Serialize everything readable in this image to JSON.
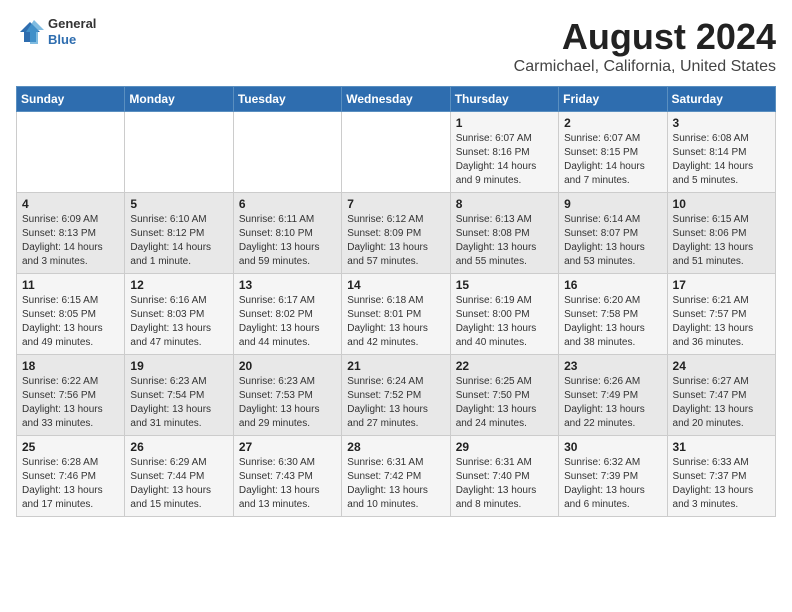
{
  "header": {
    "logo": {
      "line1": "General",
      "line2": "Blue"
    },
    "title": "August 2024",
    "subtitle": "Carmichael, California, United States"
  },
  "weekdays": [
    "Sunday",
    "Monday",
    "Tuesday",
    "Wednesday",
    "Thursday",
    "Friday",
    "Saturday"
  ],
  "weeks": [
    [
      {
        "day": "",
        "info": ""
      },
      {
        "day": "",
        "info": ""
      },
      {
        "day": "",
        "info": ""
      },
      {
        "day": "",
        "info": ""
      },
      {
        "day": "1",
        "info": "Sunrise: 6:07 AM\nSunset: 8:16 PM\nDaylight: 14 hours\nand 9 minutes."
      },
      {
        "day": "2",
        "info": "Sunrise: 6:07 AM\nSunset: 8:15 PM\nDaylight: 14 hours\nand 7 minutes."
      },
      {
        "day": "3",
        "info": "Sunrise: 6:08 AM\nSunset: 8:14 PM\nDaylight: 14 hours\nand 5 minutes."
      }
    ],
    [
      {
        "day": "4",
        "info": "Sunrise: 6:09 AM\nSunset: 8:13 PM\nDaylight: 14 hours\nand 3 minutes."
      },
      {
        "day": "5",
        "info": "Sunrise: 6:10 AM\nSunset: 8:12 PM\nDaylight: 14 hours\nand 1 minute."
      },
      {
        "day": "6",
        "info": "Sunrise: 6:11 AM\nSunset: 8:10 PM\nDaylight: 13 hours\nand 59 minutes."
      },
      {
        "day": "7",
        "info": "Sunrise: 6:12 AM\nSunset: 8:09 PM\nDaylight: 13 hours\nand 57 minutes."
      },
      {
        "day": "8",
        "info": "Sunrise: 6:13 AM\nSunset: 8:08 PM\nDaylight: 13 hours\nand 55 minutes."
      },
      {
        "day": "9",
        "info": "Sunrise: 6:14 AM\nSunset: 8:07 PM\nDaylight: 13 hours\nand 53 minutes."
      },
      {
        "day": "10",
        "info": "Sunrise: 6:15 AM\nSunset: 8:06 PM\nDaylight: 13 hours\nand 51 minutes."
      }
    ],
    [
      {
        "day": "11",
        "info": "Sunrise: 6:15 AM\nSunset: 8:05 PM\nDaylight: 13 hours\nand 49 minutes."
      },
      {
        "day": "12",
        "info": "Sunrise: 6:16 AM\nSunset: 8:03 PM\nDaylight: 13 hours\nand 47 minutes."
      },
      {
        "day": "13",
        "info": "Sunrise: 6:17 AM\nSunset: 8:02 PM\nDaylight: 13 hours\nand 44 minutes."
      },
      {
        "day": "14",
        "info": "Sunrise: 6:18 AM\nSunset: 8:01 PM\nDaylight: 13 hours\nand 42 minutes."
      },
      {
        "day": "15",
        "info": "Sunrise: 6:19 AM\nSunset: 8:00 PM\nDaylight: 13 hours\nand 40 minutes."
      },
      {
        "day": "16",
        "info": "Sunrise: 6:20 AM\nSunset: 7:58 PM\nDaylight: 13 hours\nand 38 minutes."
      },
      {
        "day": "17",
        "info": "Sunrise: 6:21 AM\nSunset: 7:57 PM\nDaylight: 13 hours\nand 36 minutes."
      }
    ],
    [
      {
        "day": "18",
        "info": "Sunrise: 6:22 AM\nSunset: 7:56 PM\nDaylight: 13 hours\nand 33 minutes."
      },
      {
        "day": "19",
        "info": "Sunrise: 6:23 AM\nSunset: 7:54 PM\nDaylight: 13 hours\nand 31 minutes."
      },
      {
        "day": "20",
        "info": "Sunrise: 6:23 AM\nSunset: 7:53 PM\nDaylight: 13 hours\nand 29 minutes."
      },
      {
        "day": "21",
        "info": "Sunrise: 6:24 AM\nSunset: 7:52 PM\nDaylight: 13 hours\nand 27 minutes."
      },
      {
        "day": "22",
        "info": "Sunrise: 6:25 AM\nSunset: 7:50 PM\nDaylight: 13 hours\nand 24 minutes."
      },
      {
        "day": "23",
        "info": "Sunrise: 6:26 AM\nSunset: 7:49 PM\nDaylight: 13 hours\nand 22 minutes."
      },
      {
        "day": "24",
        "info": "Sunrise: 6:27 AM\nSunset: 7:47 PM\nDaylight: 13 hours\nand 20 minutes."
      }
    ],
    [
      {
        "day": "25",
        "info": "Sunrise: 6:28 AM\nSunset: 7:46 PM\nDaylight: 13 hours\nand 17 minutes."
      },
      {
        "day": "26",
        "info": "Sunrise: 6:29 AM\nSunset: 7:44 PM\nDaylight: 13 hours\nand 15 minutes."
      },
      {
        "day": "27",
        "info": "Sunrise: 6:30 AM\nSunset: 7:43 PM\nDaylight: 13 hours\nand 13 minutes."
      },
      {
        "day": "28",
        "info": "Sunrise: 6:31 AM\nSunset: 7:42 PM\nDaylight: 13 hours\nand 10 minutes."
      },
      {
        "day": "29",
        "info": "Sunrise: 6:31 AM\nSunset: 7:40 PM\nDaylight: 13 hours\nand 8 minutes."
      },
      {
        "day": "30",
        "info": "Sunrise: 6:32 AM\nSunset: 7:39 PM\nDaylight: 13 hours\nand 6 minutes."
      },
      {
        "day": "31",
        "info": "Sunrise: 6:33 AM\nSunset: 7:37 PM\nDaylight: 13 hours\nand 3 minutes."
      }
    ]
  ]
}
